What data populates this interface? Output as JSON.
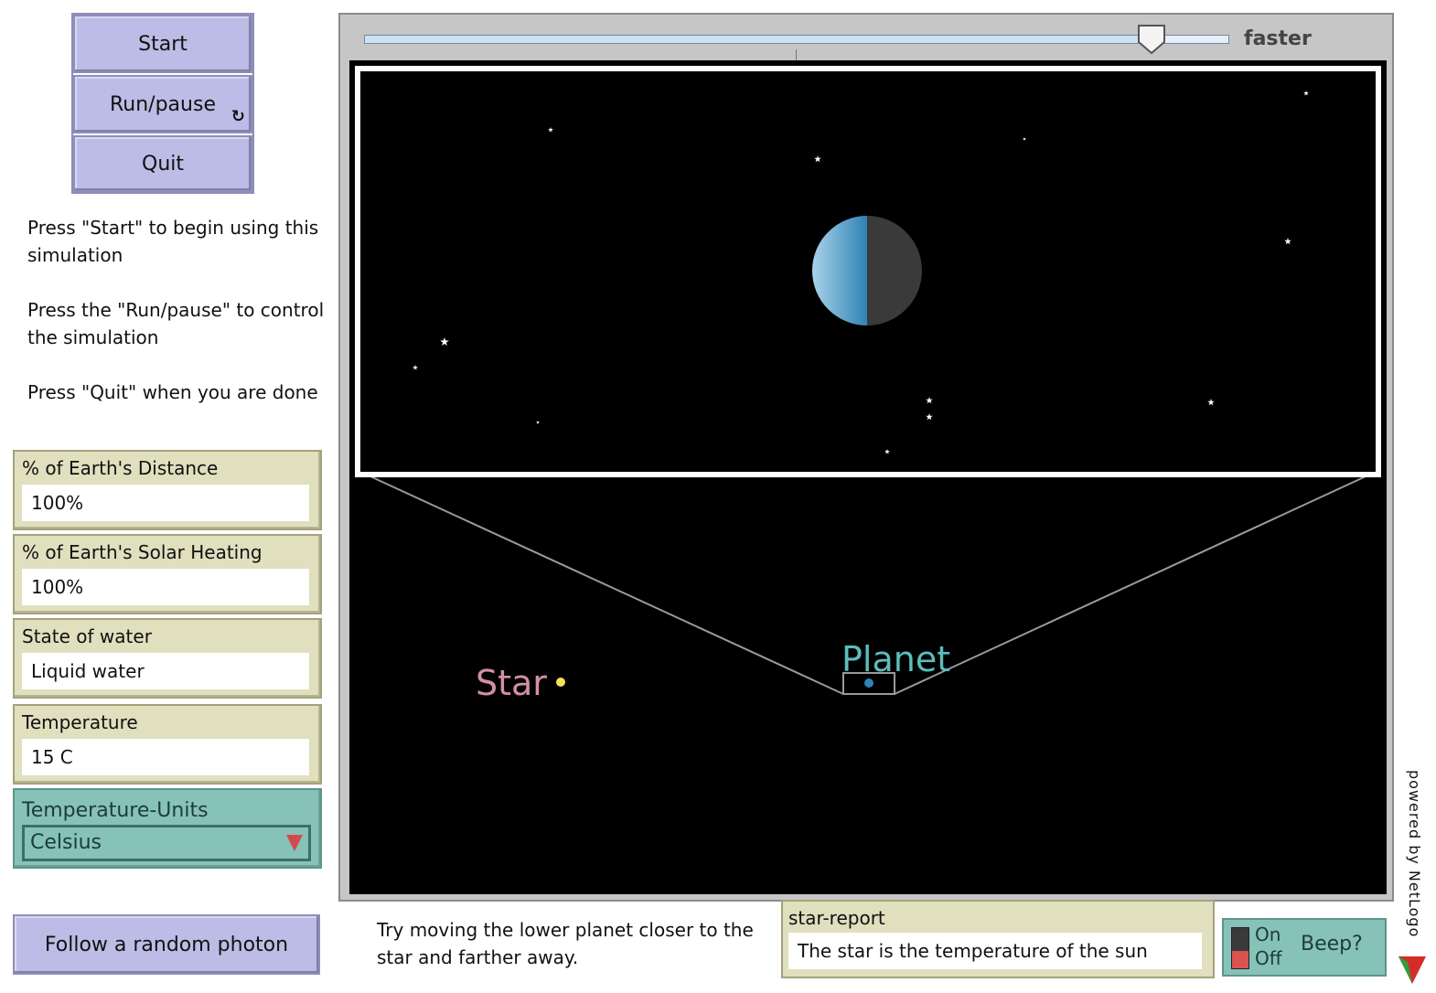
{
  "buttons": {
    "start": "Start",
    "run_pause": "Run/pause",
    "forever_icon": "forever-arrows-icon",
    "quit": "Quit",
    "follow_photon": "Follow a random photon"
  },
  "notes": {
    "start_line1": "Press \"Start\" to begin using this",
    "start_line2": "simulation",
    "run_line1": "Press the \"Run/pause\" to control",
    "run_line2": "the simulation",
    "quit": "Press \"Quit\" when you are done",
    "bottom_line1": "Try moving the lower planet closer to the",
    "bottom_line2": "star and farther away."
  },
  "monitors": [
    {
      "label": "% of Earth's Distance",
      "value": "100%"
    },
    {
      "label": "% of Earth's Solar Heating",
      "value": "100%"
    },
    {
      "label": "State of water",
      "value": "Liquid water"
    },
    {
      "label": "Temperature",
      "value": "15 C"
    }
  ],
  "chooser": {
    "label": "Temperature-Units",
    "value": "Celsius"
  },
  "speed": {
    "label": "faster",
    "position": 0.91
  },
  "world": {
    "star_label": "Star",
    "planet_label": "Planet",
    "star_color": "#f5e25a",
    "star_label_color": "#d48fa6",
    "planet_label_color": "#5cbcbc",
    "planet_color": "#2f83b4"
  },
  "star_report": {
    "label": "star-report",
    "value": "The star is the temperature of the sun"
  },
  "switch": {
    "on": "On",
    "off": "Off",
    "label": "Beep?",
    "state": "off"
  },
  "branding": {
    "powered": "powered by NetLogo"
  },
  "colors": {
    "button": "#bcbce6",
    "monitor": "#e0dfbe",
    "chooser": "#86c2b8",
    "view_bg": "#000000"
  }
}
